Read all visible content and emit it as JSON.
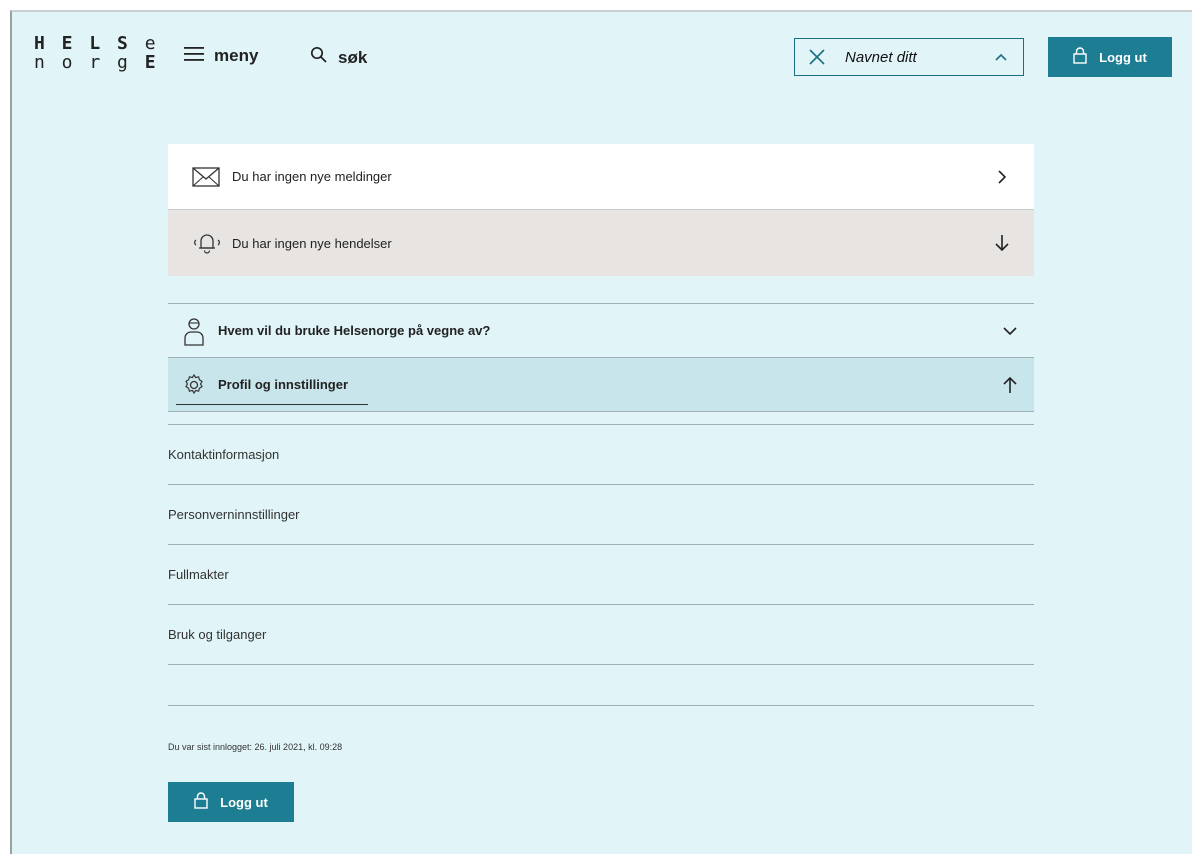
{
  "header": {
    "logo_line1_a": "H E L S",
    "logo_line1_b": "e",
    "logo_line2_a": "n o r g",
    "logo_line2_b": "E",
    "menu_label": "meny",
    "search_label": "søk",
    "name_label": "Navnet ditt",
    "logout_label": "Logg ut"
  },
  "notifications": {
    "messages_text": "Du har ingen nye meldinger",
    "events_text": "Du har ingen nye hendelser"
  },
  "accordion": {
    "who_label": "Hvem vil du bruke Helsenorge på vegne av?",
    "profile_label": "Profil og innstillinger"
  },
  "profile_items": [
    "Kontaktinformasjon",
    "Personverninnstillinger",
    "Fullmakter",
    "Bruk og tilganger"
  ],
  "footer": {
    "last_login": "Du var sist innlogget: 26. juli 2021, kl. 09:28",
    "logout_label": "Logg ut"
  },
  "colors": {
    "page_bg": "#e1f4f8",
    "accent": "#1d7d92",
    "profile_row_bg": "#c8e5ec",
    "events_row_bg": "#e7e4e2"
  },
  "icons": [
    "menu-icon",
    "search-icon",
    "close-icon",
    "chevron-up-icon",
    "lock-icon",
    "envelope-icon",
    "bell-icon",
    "chevron-right-icon",
    "arrow-down-icon",
    "person-icon",
    "chevron-down-icon",
    "gear-icon",
    "arrow-up-icon"
  ]
}
